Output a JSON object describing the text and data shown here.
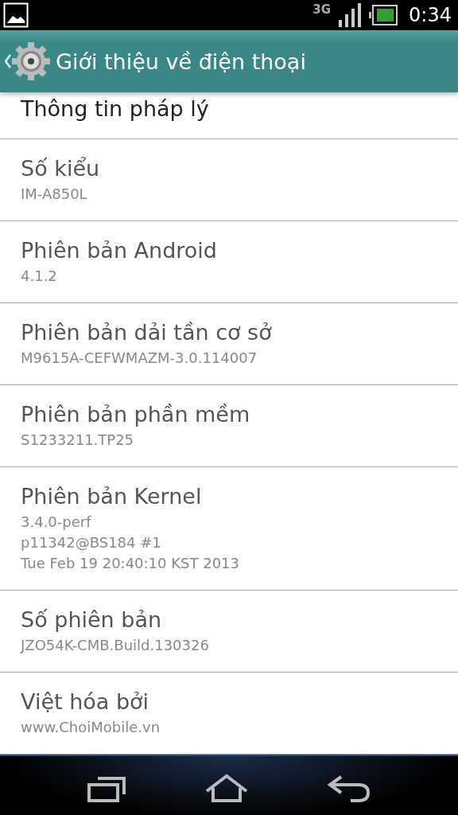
{
  "status_bar": {
    "network": "3G",
    "time": "0:34"
  },
  "action_bar": {
    "title": "Giới thiệu về điện thoại"
  },
  "items": [
    {
      "title": "Thông tin pháp lý"
    },
    {
      "title": "Số kiểu",
      "summary": "IM-A850L"
    },
    {
      "title": "Phiên bản Android",
      "summary": "4.1.2"
    },
    {
      "title": "Phiên bản dải tần cơ sở",
      "summary": "M9615A-CEFWMAZM-3.0.114007"
    },
    {
      "title": "Phiên bản phần mềm",
      "summary": "S1233211.TP25"
    },
    {
      "title": "Phiên bản Kernel",
      "summary": "3.4.0-perf\np11342@BS184 #1\nTue Feb 19 20:40:10 KST 2013"
    },
    {
      "title": "Số phiên bản",
      "summary": "JZO54K-CMB.Build.130326"
    },
    {
      "title": "Việt hóa bởi",
      "summary": "www.ChoiMobile.vn"
    }
  ]
}
